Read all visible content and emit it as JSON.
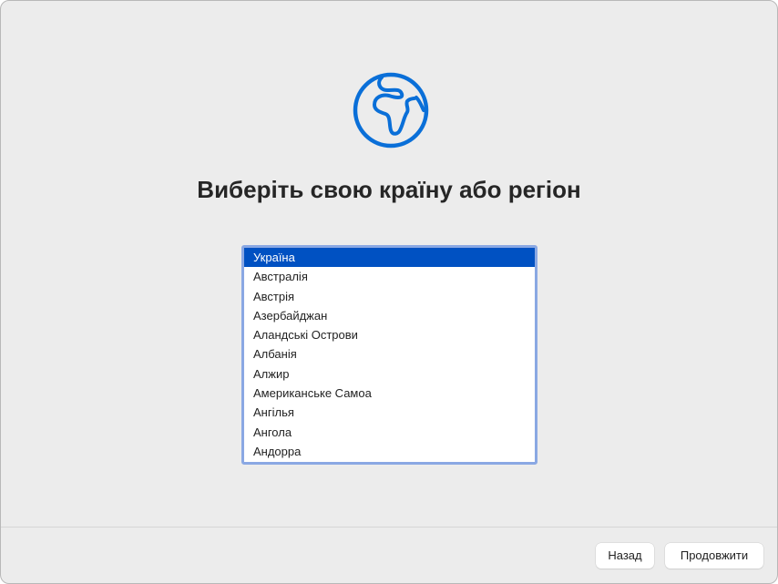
{
  "title": "Виберіть свою країну або регіон",
  "accent_color": "#0a6fd8",
  "countries": [
    {
      "label": "Україна",
      "selected": true
    },
    {
      "label": "Австралія"
    },
    {
      "label": "Австрія"
    },
    {
      "label": "Азербайджан"
    },
    {
      "label": "Аландські Острови"
    },
    {
      "label": "Албанія"
    },
    {
      "label": "Алжир"
    },
    {
      "label": "Американське Самоа"
    },
    {
      "label": "Ангілья"
    },
    {
      "label": "Ангола"
    },
    {
      "label": "Андорра"
    }
  ],
  "buttons": {
    "back": "Назад",
    "continue": "Продовжити"
  }
}
